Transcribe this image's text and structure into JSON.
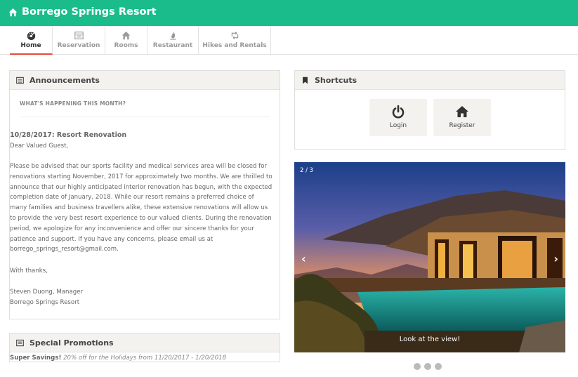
{
  "header": {
    "title": "Borrego Springs Resort",
    "icon": "home-icon"
  },
  "nav": {
    "tabs": [
      {
        "label": "Home",
        "icon": "dashboard-icon",
        "active": true
      },
      {
        "label": "Reservation",
        "icon": "calendar-icon",
        "active": false
      },
      {
        "label": "Rooms",
        "icon": "home-icon",
        "active": false
      },
      {
        "label": "Restaurant",
        "icon": "fire-icon",
        "active": false
      },
      {
        "label": "Hikes and Rentals",
        "icon": "retweet-icon",
        "active": false
      }
    ]
  },
  "announcements": {
    "heading": "Announcements",
    "subheading": "WHAT'S HAPPENING THIS MONTH?",
    "post_title": "10/28/2017: Resort Renovation",
    "greeting": "Dear Valued Guest,",
    "body_lines": [
      "Please be advised that our sports facility and medical services area will be closed for",
      "renovations starting November, 2017 for approximately two months. We are thrilled to",
      "announce that our highly anticipated interior renovation has begun, with the expected",
      "completion date of January, 2018. While our resort remains a preferred choice of",
      "many families and business travellers alike, these extensive renovations will allow us",
      "to provide the very best resort experience to our valued clients. During the renovation",
      "period, we apologize for any inconvenience and offer our sincere thanks for your",
      "patience and support. If you have any concerns, please email us at",
      "borrego_springs_resort@gmail.com."
    ],
    "closing": "With thanks,",
    "signature_name": "Steven Duong, Manager",
    "signature_org": "Borrego Springs Resort"
  },
  "shortcuts": {
    "heading": "Shortcuts",
    "items": [
      {
        "label": "Login",
        "icon": "power-icon"
      },
      {
        "label": "Register",
        "icon": "home-icon"
      }
    ]
  },
  "carousel": {
    "counter": "2 / 3",
    "caption": "Look at the view!",
    "prev": "‹",
    "next": "›",
    "slides_total": 3,
    "active_slide": 2
  },
  "promotions": {
    "heading": "Special Promotions",
    "bold": "Super Savings!",
    "text": "20% off for the Holidays from 11/20/2017 - 1/20/2018"
  },
  "colors": {
    "brand": "#1abc8c",
    "active_tab": "#e74c3c",
    "panel_header": "#f4f2ef"
  }
}
